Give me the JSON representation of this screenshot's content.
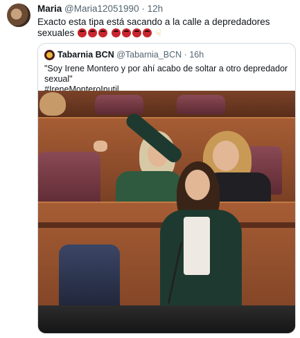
{
  "tweet": {
    "author_name": "Maria",
    "author_handle": "@Maria12051990",
    "separator": "·",
    "time": "12h",
    "text": "Exacto esta tipa está sacando a la calle a depredadores sexuales"
  },
  "quoted_tweet": {
    "author_name": "Tabarnia BCN",
    "author_handle": "@Tabarnia_BCN",
    "separator": "·",
    "time": "16h",
    "text": "\"Soy Irene Montero y por ahí acabo de soltar a otro depredador sexual\"",
    "hashtag": "#IreneMonteroInutil"
  },
  "icons": {
    "emoji_angry": "angry-face-icon",
    "emoji_hand": "pointing-down-hand-icon"
  },
  "colors": {
    "text": "#0f1419",
    "secondary": "#536471",
    "border": "#cfd9de",
    "emoji_red": "#c6262e"
  }
}
